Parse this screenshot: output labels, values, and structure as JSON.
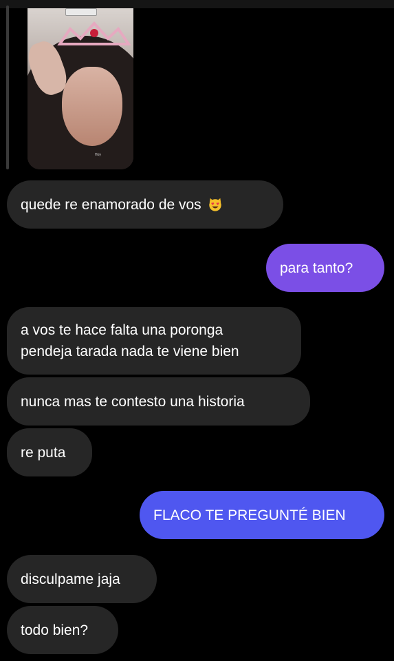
{
  "story": {
    "caption": "Hoy"
  },
  "messages": [
    {
      "id": "m1",
      "side": "received",
      "text": "quede re enamorado de vos",
      "emoji": "smiling-cat-heart-eyes-icon"
    },
    {
      "id": "m2",
      "side": "sent",
      "text": "para tanto?",
      "color": "#7b4fe6"
    },
    {
      "id": "m3",
      "side": "received",
      "lines": [
        "a vos te hace falta una poronga",
        "pendeja tarada nada te viene bien"
      ]
    },
    {
      "id": "m4",
      "side": "received",
      "text": "nunca mas te contesto una historia"
    },
    {
      "id": "m5",
      "side": "received",
      "text": "re puta"
    },
    {
      "id": "m6",
      "side": "sent",
      "text": "FLACO TE PREGUNTÉ BIEN",
      "color": "#4f57f0"
    },
    {
      "id": "m7",
      "side": "received",
      "text": "disculpame jaja"
    },
    {
      "id": "m8",
      "side": "received",
      "text": "todo bien?"
    }
  ],
  "colors": {
    "background": "#000000",
    "received_bubble": "#262626",
    "sent_top": "#7b4fe6",
    "sent_bottom": "#4f57f0"
  }
}
